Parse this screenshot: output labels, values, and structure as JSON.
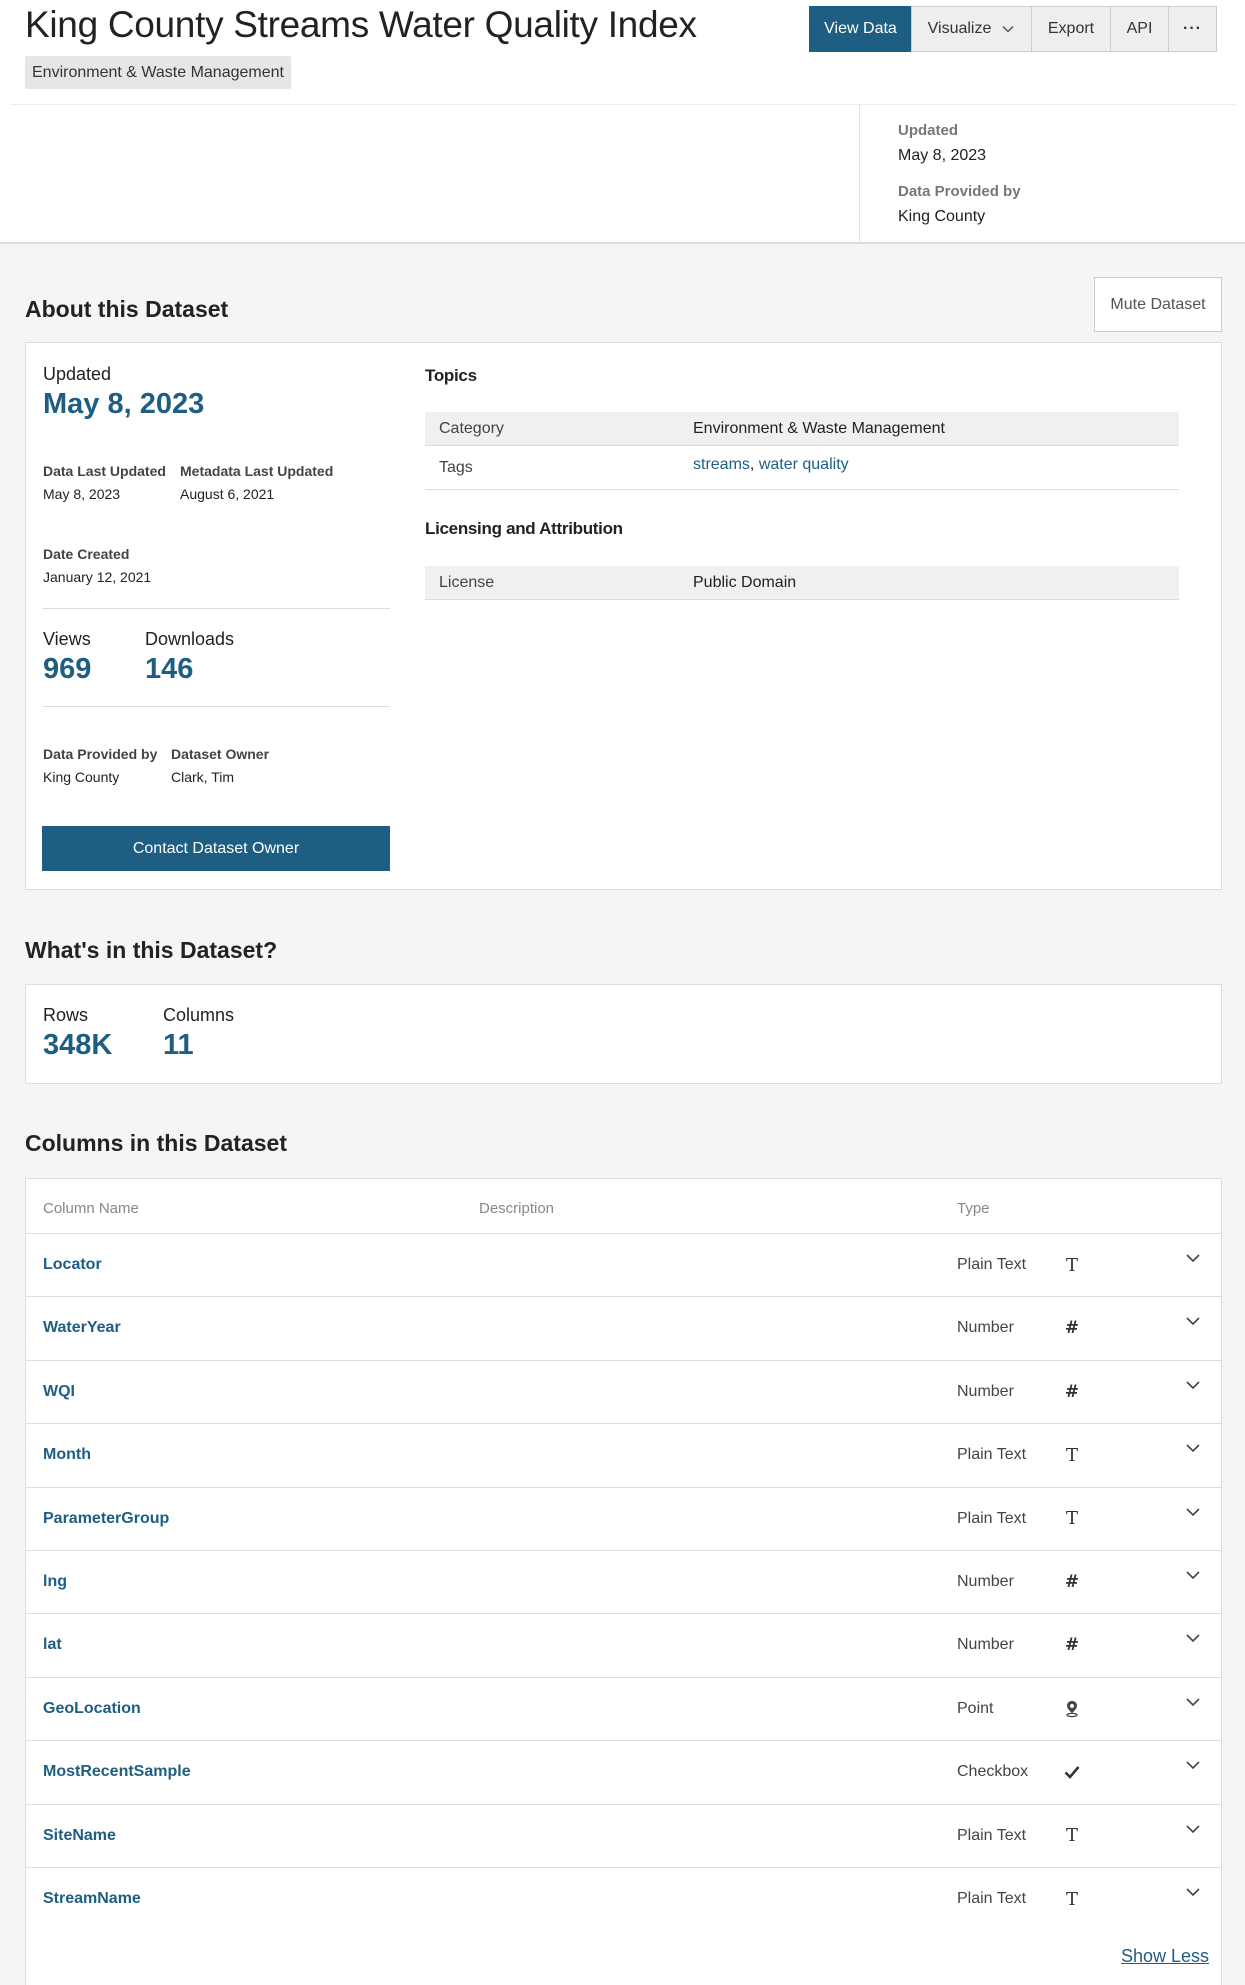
{
  "header": {
    "title": "King County Streams Water Quality Index",
    "category_pill": "Environment & Waste Management",
    "buttons": {
      "view_data": "View Data",
      "visualize": "Visualize",
      "export": "Export",
      "api": "API",
      "more": "···"
    },
    "meta": {
      "updated_label": "Updated",
      "updated_value": "May 8, 2023",
      "provided_label": "Data Provided by",
      "provided_value": "King County"
    }
  },
  "about": {
    "title": "About this Dataset",
    "mute_button": "Mute Dataset",
    "updated_label": "Updated",
    "updated_value": "May 8, 2023",
    "data_last_updated_label": "Data Last Updated",
    "data_last_updated_value": "May 8, 2023",
    "metadata_last_updated_label": "Metadata Last Updated",
    "metadata_last_updated_value": "August 6, 2021",
    "date_created_label": "Date Created",
    "date_created_value": "January 12, 2021",
    "views_label": "Views",
    "views_value": "969",
    "downloads_label": "Downloads",
    "downloads_value": "146",
    "provided_label": "Data Provided by",
    "provided_value": "King County",
    "owner_label": "Dataset Owner",
    "owner_value": "Clark, Tim",
    "contact_button": "Contact Dataset Owner",
    "topics_title": "Topics",
    "category_key": "Category",
    "category_value": "Environment & Waste Management",
    "tags_key": "Tags",
    "tags": [
      "streams",
      "water quality"
    ],
    "tag_separator": ",",
    "licensing_title": "Licensing and Attribution",
    "license_key": "License",
    "license_value": "Public Domain"
  },
  "whats_in": {
    "title": "What's in this Dataset?",
    "rows_label": "Rows",
    "rows_value": "348K",
    "columns_label": "Columns",
    "columns_value": "11"
  },
  "columns_section": {
    "title": "Columns in this Dataset",
    "headers": {
      "name": "Column Name",
      "description": "Description",
      "type": "Type"
    },
    "columns": [
      {
        "name": "Locator",
        "type": "Plain Text",
        "icon": "text-icon"
      },
      {
        "name": "WaterYear",
        "type": "Number",
        "icon": "number-icon"
      },
      {
        "name": "WQI",
        "type": "Number",
        "icon": "number-icon"
      },
      {
        "name": "Month",
        "type": "Plain Text",
        "icon": "text-icon"
      },
      {
        "name": "ParameterGroup",
        "type": "Plain Text",
        "icon": "text-icon"
      },
      {
        "name": "lng",
        "type": "Number",
        "icon": "number-icon"
      },
      {
        "name": "lat",
        "type": "Number",
        "icon": "number-icon"
      },
      {
        "name": "GeoLocation",
        "type": "Point",
        "icon": "map-pin-icon"
      },
      {
        "name": "MostRecentSample",
        "type": "Checkbox",
        "icon": "checkmark-icon"
      },
      {
        "name": "SiteName",
        "type": "Plain Text",
        "icon": "text-icon"
      },
      {
        "name": "StreamName",
        "type": "Plain Text",
        "icon": "text-icon"
      }
    ],
    "show_less": "Show Less"
  },
  "colors": {
    "accent": "#1e5e82",
    "page_background": "#f5f5f5"
  }
}
